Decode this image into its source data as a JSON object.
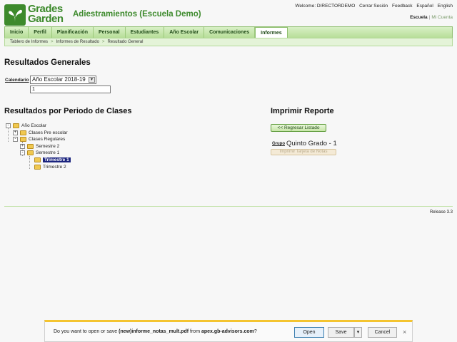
{
  "header": {
    "logo_line1": "Grades",
    "logo_line2": "Garden",
    "school_title": "Adiestramientos (Escuela Demo)",
    "welcome": "Welcome: DIRECTORDEMO",
    "logout": "Cerrar Sesión",
    "feedback": "Feedback",
    "lang_es": "Español",
    "lang_en": "English",
    "school_current": "Escuela",
    "school_separator": "|",
    "school_other": "Mi Cuenta"
  },
  "nav": {
    "tabs": [
      {
        "label": "Inicio"
      },
      {
        "label": "Perfil"
      },
      {
        "label": "Planificación"
      },
      {
        "label": "Personal"
      },
      {
        "label": "Estudiantes"
      },
      {
        "label": "Año Escolar"
      },
      {
        "label": "Comunicaciones"
      },
      {
        "label": "Informes"
      }
    ],
    "active": "Informes"
  },
  "breadcrumb": [
    "Tablero de Informes",
    "Informes de Resultado",
    "Resultado General"
  ],
  "breadcrumb_separator": ">",
  "main": {
    "title": "Resultados Generales",
    "calendar_label": "Calendario",
    "calendar_value": "Año Escolar 2018-19",
    "calendar_input_value": "1",
    "periodo_title": "Resultados por Periodo de Clases",
    "imprimir_title": "Imprimir Reporte",
    "regresar_label": "<< Regresar Listado",
    "grupo_label": "Grupo",
    "grupo_value": "Quinto Grado - 1",
    "tarjeta_label": "Imprimir Tarjeta de Notas"
  },
  "tree": [
    {
      "label": "Año Escolar",
      "toggle": "-"
    },
    {
      "label": "Clases Pre escolar",
      "toggle": "+"
    },
    {
      "label": "Clases Regulares",
      "toggle": "-"
    },
    {
      "label": "Semestre 2",
      "toggle": "+"
    },
    {
      "label": "Semestre 1",
      "toggle": "-"
    },
    {
      "label": "Trimestre 1",
      "selected": true
    },
    {
      "label": "Trimestre 2"
    }
  ],
  "footer": {
    "release": "Release 3.3"
  },
  "download_bar": {
    "prefix": "Do you want to open or save ",
    "filename": "(new)informe_notas_mult.pdf",
    "middle": " from ",
    "source": "apex.gb-advisors.com",
    "suffix": "?",
    "open_label": "Open",
    "save_label": "Save",
    "save_arrow": "▾",
    "cancel_label": "Cancel",
    "close_glyph": "×"
  },
  "colors": {
    "brand": "#3d8a2c",
    "nav_bg": "#c7e6a8",
    "selected": "#1a237e",
    "notify": "#f4c430"
  }
}
